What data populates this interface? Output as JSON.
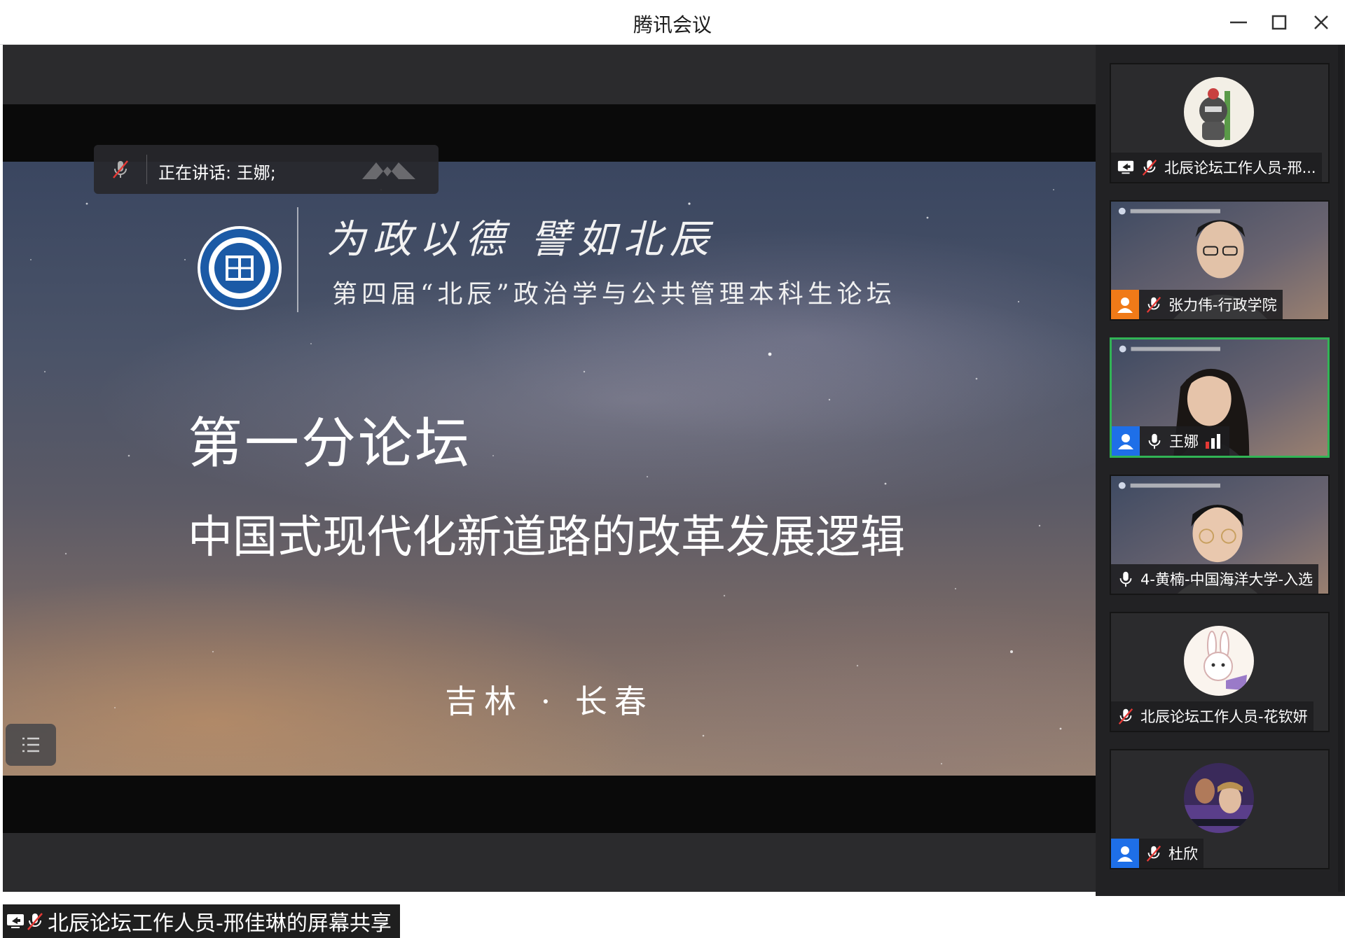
{
  "window": {
    "title": "腾讯会议",
    "controls": [
      "minimize-icon",
      "maximize-icon",
      "close-icon"
    ]
  },
  "stage": {
    "speaking_banner": {
      "label": "正在讲话: 王娜;"
    },
    "slide": {
      "slogan": "为政以德 譬如北辰",
      "forum_name": "第四届“北辰”政治学与公共管理本科生论坛",
      "sub_forum": "第一分论坛",
      "topic": "中国式现代化新道路的改革发展逻辑",
      "place": "吉林 · 长春"
    },
    "screen_share_label": "北辰论坛工作人员-邢佳琳的屏幕共享"
  },
  "participants": [
    {
      "name": "北辰论坛工作人员-邢...",
      "audio": "muted",
      "sharing": true,
      "video": false,
      "active": false
    },
    {
      "name": "张力伟-行政学院",
      "audio": "muted",
      "sharing": false,
      "video": true,
      "active": false,
      "avatar_color": "#f07a18"
    },
    {
      "name": "王娜",
      "audio": "speaking",
      "sharing": false,
      "video": true,
      "active": true,
      "avatar_color": "#1e6fe8"
    },
    {
      "name": "4-黄楠-中国海洋大学-入选",
      "audio": "on",
      "sharing": false,
      "video": true,
      "active": false
    },
    {
      "name": "北辰论坛工作人员-花钦妍",
      "audio": "muted",
      "sharing": false,
      "video": false,
      "active": false
    },
    {
      "name": "杜欣",
      "audio": "muted",
      "sharing": false,
      "video": false,
      "active": false,
      "avatar_color": "#1e6fe8"
    }
  ],
  "colors": {
    "active_border": "#31b455",
    "user_badge_blue": "#1e6fe8",
    "user_badge_orange": "#f07a18",
    "mute_red": "#e53935"
  }
}
